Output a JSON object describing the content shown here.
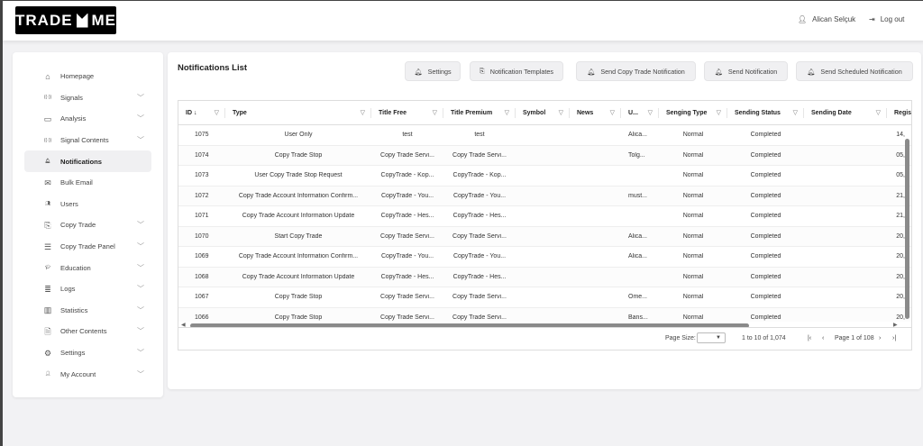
{
  "header": {
    "logo": "TRADE ME",
    "user": "Alican Selçuk",
    "logout": "Log out"
  },
  "sidebar": {
    "items": [
      {
        "label": "Homepage",
        "icon": "⌂",
        "chev": false
      },
      {
        "label": "Signals",
        "icon": "((·))",
        "chev": true
      },
      {
        "label": "Analysis",
        "icon": "▭",
        "chev": true
      },
      {
        "label": "Signal Contents",
        "icon": "((·))",
        "chev": true
      },
      {
        "label": "Notifications",
        "icon": "🔔︎",
        "chev": false,
        "active": true
      },
      {
        "label": "Bulk Email",
        "icon": "✉",
        "chev": false
      },
      {
        "label": "Users",
        "icon": "👥︎",
        "chev": false
      },
      {
        "label": "Copy Trade",
        "icon": "⎘",
        "chev": true
      },
      {
        "label": "Copy Trade Panel",
        "icon": "☰",
        "chev": true
      },
      {
        "label": "Education",
        "icon": "🎓︎",
        "chev": true
      },
      {
        "label": "Logs",
        "icon": "≣",
        "chev": true
      },
      {
        "label": "Statistics",
        "icon": "▥",
        "chev": true
      },
      {
        "label": "Other Contents",
        "icon": "🗎",
        "chev": true
      },
      {
        "label": "Settings",
        "icon": "⚙",
        "chev": true
      },
      {
        "label": "My Account",
        "icon": "👤︎",
        "chev": true
      }
    ]
  },
  "main": {
    "title": "Notifications List",
    "buttons": [
      "Settings",
      "Notification Templates",
      "Send Copy Trade Notification",
      "Send Notification",
      "Send Scheduled Notification"
    ]
  },
  "grid": {
    "columns": [
      "ID ↓",
      "Type",
      "Title Free",
      "Title Premium",
      "Symbol",
      "News",
      "U...",
      "Senging Type",
      "Sending Status",
      "Sending Date",
      "Regist"
    ],
    "rows": [
      [
        "1075",
        "User Only",
        "test",
        "test",
        "",
        "",
        "Alica...",
        "Normal",
        "Completed",
        "",
        "14,"
      ],
      [
        "1074",
        "Copy Trade Stop",
        "Copy Trade Servi...",
        "Copy Trade Servi...",
        "",
        "",
        "Tolg...",
        "Normal",
        "Completed",
        "",
        "05,"
      ],
      [
        "1073",
        "User Copy Trade Stop Request",
        "CopyTrade - Kop...",
        "CopyTrade - Kop...",
        "",
        "",
        "",
        "Normal",
        "Completed",
        "",
        "05,"
      ],
      [
        "1072",
        "Copy Trade Account Information Confirm...",
        "CopyTrade - You...",
        "CopyTrade - You...",
        "",
        "",
        "must...",
        "Normal",
        "Completed",
        "",
        "21,"
      ],
      [
        "1071",
        "Copy Trade Account Information Update",
        "CopyTrade - Hes...",
        "CopyTrade - Hes...",
        "",
        "",
        "",
        "Normal",
        "Completed",
        "",
        "21,"
      ],
      [
        "1070",
        "Start Copy Trade",
        "Copy Trade Servi...",
        "Copy Trade Servi...",
        "",
        "",
        "Alica...",
        "Normal",
        "Completed",
        "",
        "20,"
      ],
      [
        "1069",
        "Copy Trade Account Information Confirm...",
        "CopyTrade - You...",
        "CopyTrade - You...",
        "",
        "",
        "Alica...",
        "Normal",
        "Completed",
        "",
        "20,"
      ],
      [
        "1068",
        "Copy Trade Account Information Update",
        "CopyTrade - Hes...",
        "CopyTrade - Hes...",
        "",
        "",
        "",
        "Normal",
        "Completed",
        "",
        "20,"
      ],
      [
        "1067",
        "Copy Trade Stop",
        "Copy Trade Servi...",
        "Copy Trade Servi...",
        "",
        "",
        "Öme...",
        "Normal",
        "Completed",
        "",
        "20,"
      ],
      [
        "1066",
        "Copy Trade Stop",
        "Copy Trade Servi...",
        "Copy Trade Servi...",
        "",
        "",
        "Bans...",
        "Normal",
        "Completed",
        "",
        "20,"
      ]
    ]
  },
  "footer": {
    "page_size_label": "Page Size:",
    "range": "1 to 10 of 1,074",
    "page": "Page 1 of 108"
  }
}
